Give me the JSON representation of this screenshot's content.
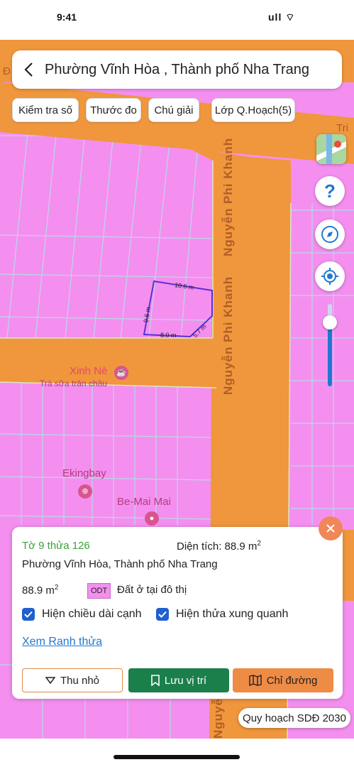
{
  "status": {
    "time": "9:41",
    "signal": "ull ⌔"
  },
  "header": {
    "title": "Phường Vĩnh Hòa , Thành phố Nha Trang"
  },
  "toolbar": {
    "chips": [
      "Kiểm tra số",
      "Thước đo",
      "Chú giải",
      "Lớp Q.Hoạch(5)"
    ]
  },
  "map": {
    "road_name": "Nguyễn Phi Khanh",
    "poi": [
      {
        "name": "Xinh Nè",
        "sub": "Trà sữa trân châu"
      },
      {
        "name": "Ekingbay"
      },
      {
        "name": "Be-Mai Mai"
      }
    ],
    "edge_labels": {
      "top_left": "Đ",
      "top_right": "Tri"
    },
    "parcel_dimensions": {
      "top": "10.6 m",
      "left": "9.6 m",
      "bottom": "8.0 m",
      "right": "5.7 m"
    },
    "zoom_level": 0.15,
    "colors": {
      "residential": "#f48ff0",
      "road": "#f0963c",
      "parcel_outline": "#5a2fd6"
    }
  },
  "card": {
    "parcel_id": "Tờ 9 thửa 126",
    "area_label": "Diện tích: 88.9 m",
    "area_sup": "2",
    "ward": "Phường Vĩnh Hòa, Thành phố Nha Trang",
    "area_value": "88.9 m",
    "area_value_sup": "2",
    "land_code": "ODT",
    "land_type": "Đất ở tại đô thị",
    "checkbox_edges": "Hiện chiều dài cạnh",
    "checkbox_neighbors": "Hiện thửa xung quanh",
    "link_view_boundary": "Xem Ranh thửa",
    "btn_collapse": "Thu nhỏ",
    "btn_save": "Lưu vị trí",
    "btn_directions": "Chỉ đường"
  },
  "plan_label": "Quy hoạch SDĐ 2030"
}
